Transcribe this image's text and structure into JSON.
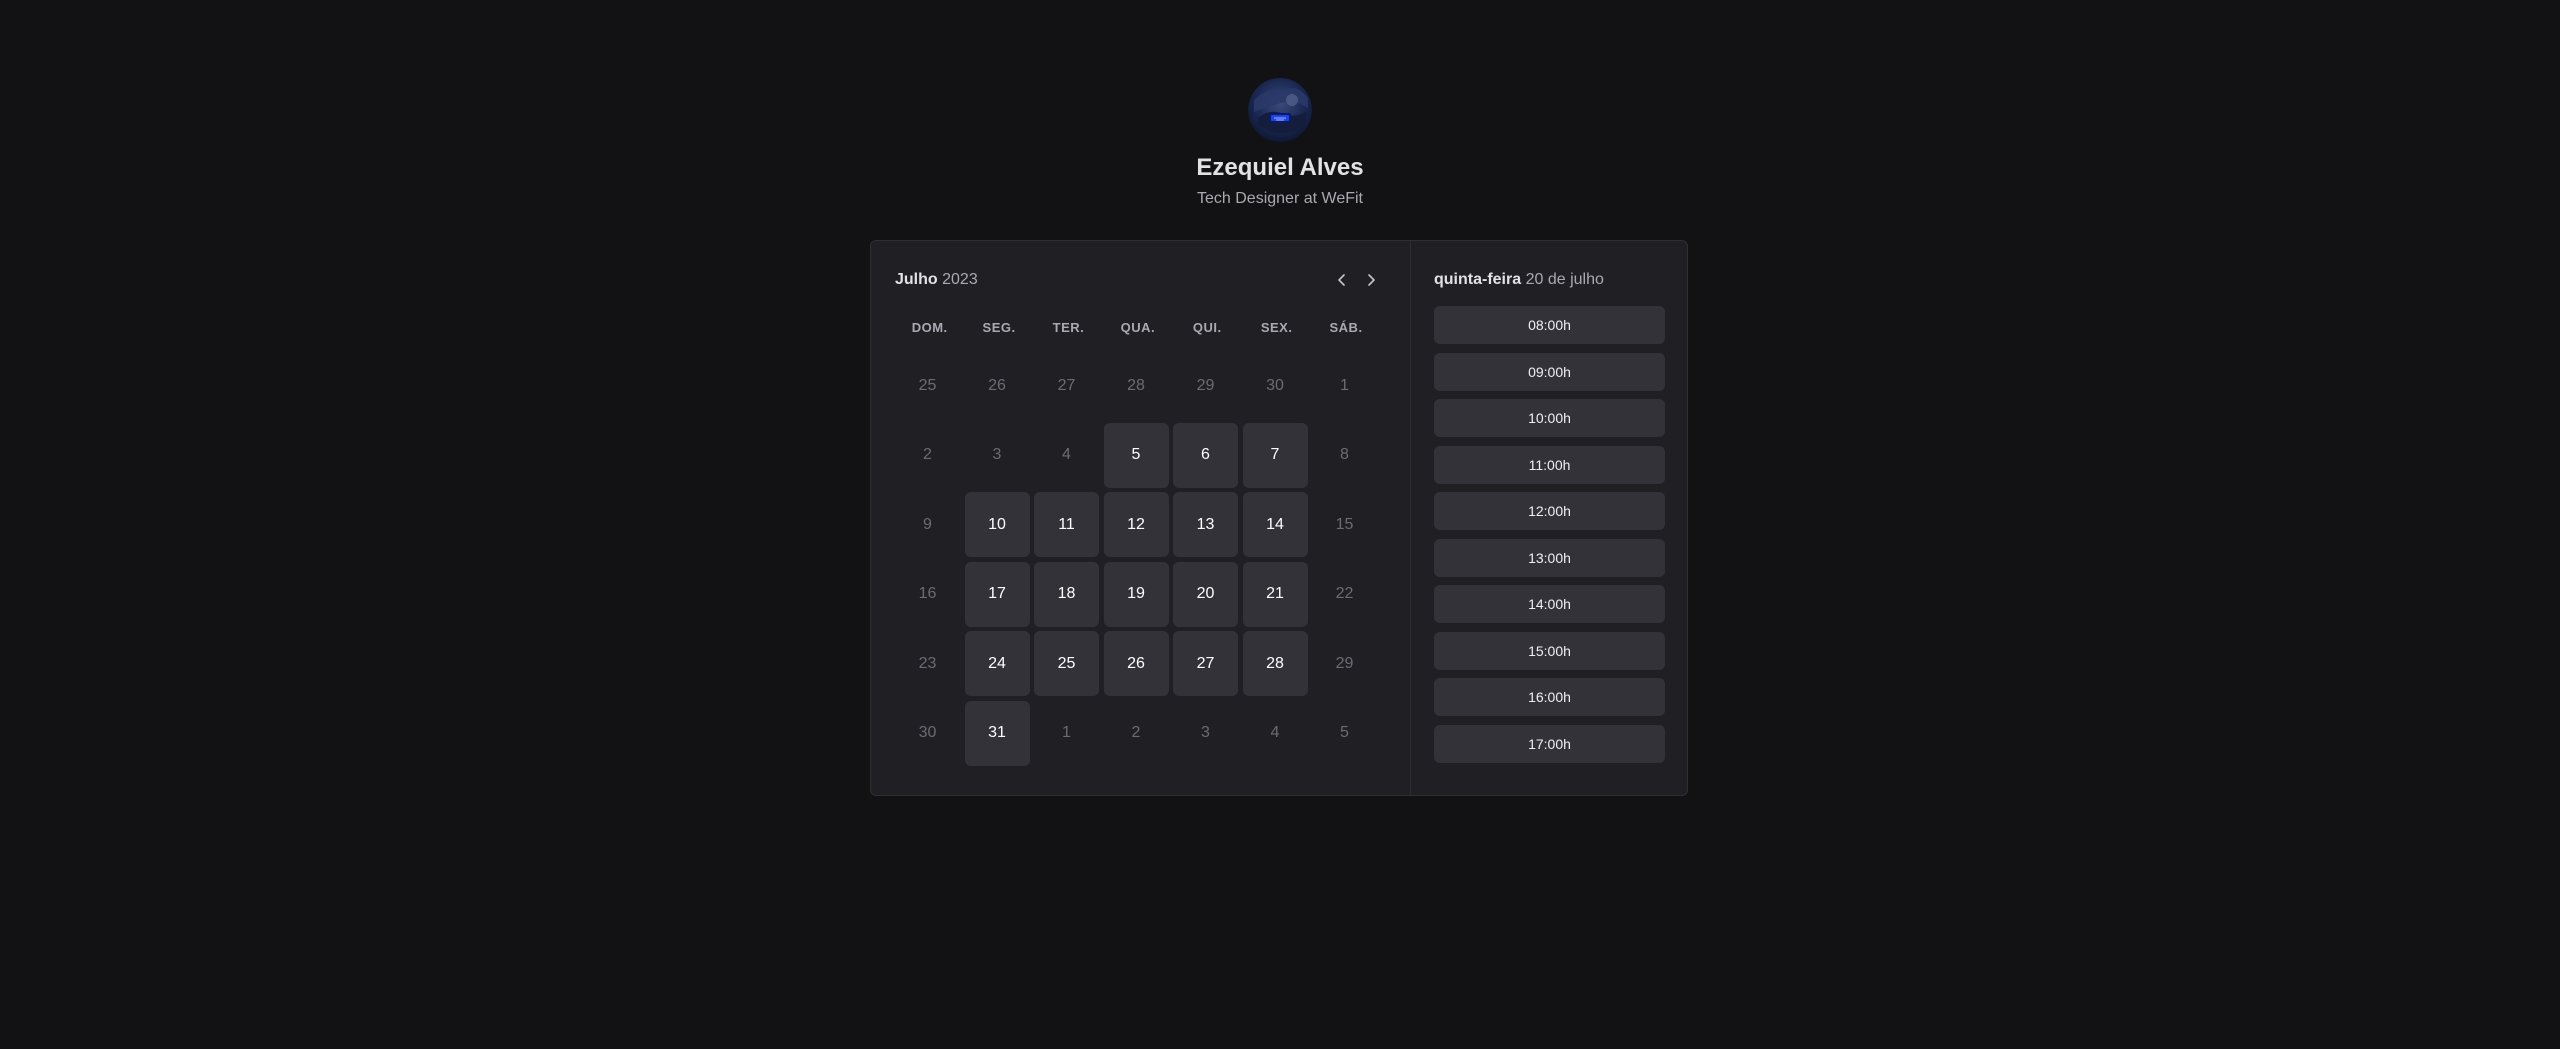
{
  "profile": {
    "name": "Ezequiel Alves",
    "bio": "Tech Designer at WeFit",
    "avatar_icon": "avatar-photo"
  },
  "calendar": {
    "month": "Julho",
    "year": "2023",
    "prev_icon": "chevron-left-icon",
    "next_icon": "chevron-right-icon",
    "weekdays": [
      "DOM.",
      "SEG.",
      "TER.",
      "QUA.",
      "QUI.",
      "SEX.",
      "SÁB."
    ],
    "weeks": [
      [
        {
          "d": "25",
          "available": false
        },
        {
          "d": "26",
          "available": false
        },
        {
          "d": "27",
          "available": false
        },
        {
          "d": "28",
          "available": false
        },
        {
          "d": "29",
          "available": false
        },
        {
          "d": "30",
          "available": false
        },
        {
          "d": "1",
          "available": false
        }
      ],
      [
        {
          "d": "2",
          "available": false
        },
        {
          "d": "3",
          "available": false
        },
        {
          "d": "4",
          "available": false
        },
        {
          "d": "5",
          "available": true
        },
        {
          "d": "6",
          "available": true
        },
        {
          "d": "7",
          "available": true
        },
        {
          "d": "8",
          "available": false
        }
      ],
      [
        {
          "d": "9",
          "available": false
        },
        {
          "d": "10",
          "available": true
        },
        {
          "d": "11",
          "available": true
        },
        {
          "d": "12",
          "available": true
        },
        {
          "d": "13",
          "available": true
        },
        {
          "d": "14",
          "available": true
        },
        {
          "d": "15",
          "available": false
        }
      ],
      [
        {
          "d": "16",
          "available": false
        },
        {
          "d": "17",
          "available": true
        },
        {
          "d": "18",
          "available": true
        },
        {
          "d": "19",
          "available": true
        },
        {
          "d": "20",
          "available": true
        },
        {
          "d": "21",
          "available": true
        },
        {
          "d": "22",
          "available": false
        }
      ],
      [
        {
          "d": "23",
          "available": false
        },
        {
          "d": "24",
          "available": true
        },
        {
          "d": "25",
          "available": true
        },
        {
          "d": "26",
          "available": true
        },
        {
          "d": "27",
          "available": true
        },
        {
          "d": "28",
          "available": true
        },
        {
          "d": "29",
          "available": false
        }
      ],
      [
        {
          "d": "30",
          "available": false
        },
        {
          "d": "31",
          "available": true
        },
        {
          "d": "1",
          "available": false
        },
        {
          "d": "2",
          "available": false
        },
        {
          "d": "3",
          "available": false
        },
        {
          "d": "4",
          "available": false
        },
        {
          "d": "5",
          "available": false
        }
      ]
    ]
  },
  "time_picker": {
    "weekday": "quinta-feira",
    "date": "20 de julho",
    "slots": [
      "08:00h",
      "09:00h",
      "10:00h",
      "11:00h",
      "12:00h",
      "13:00h",
      "14:00h",
      "15:00h",
      "16:00h",
      "17:00h"
    ]
  },
  "colors": {
    "background": "#121214",
    "panel": "#202024",
    "cell": "#323238",
    "text": "#e1e1e6",
    "muted": "#6b6b73"
  }
}
